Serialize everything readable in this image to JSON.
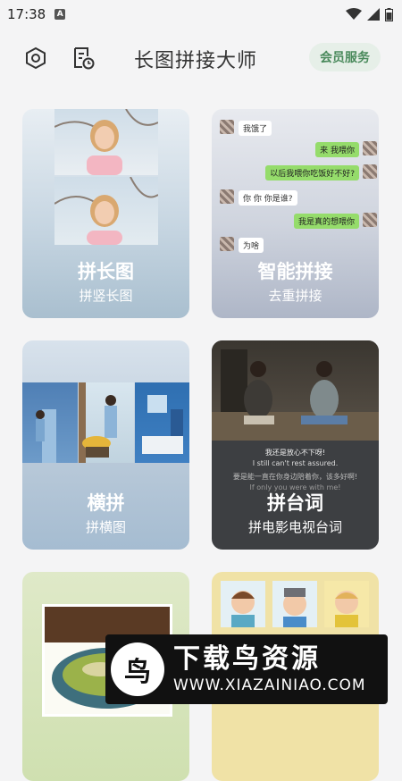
{
  "status": {
    "time": "17:38",
    "notif_badge": "A"
  },
  "header": {
    "title": "长图拼接大师",
    "vip_label": "会员服务",
    "icons": [
      "settings-hex-icon",
      "history-icon"
    ]
  },
  "cards": [
    {
      "title": "拼长图",
      "subtitle": "拼竖长图"
    },
    {
      "title": "智能拼接",
      "subtitle": "去重拼接",
      "chat": [
        "我饿了",
        "来 我喂你",
        "以后我喂你吃饭好不好?",
        "你 你 你是谁?",
        "我是真的想喂你",
        "为啥"
      ]
    },
    {
      "title": "横拼",
      "subtitle": "拼横图"
    },
    {
      "title": "拼台词",
      "subtitle": "拼电影电视台词",
      "subtitles": [
        "我还是放心不下呀!",
        "I still can't rest assured.",
        "要是能一直在你身边陪着你，该多好啊!",
        "If only you were with me!"
      ]
    },
    {
      "title": "",
      "subtitle": ""
    },
    {
      "title": "",
      "subtitle": ""
    }
  ],
  "watermark": {
    "brand": "下载鸟资源",
    "url": "WWW.XIAZAINIAO.COM",
    "logo_glyph": "鸟"
  },
  "colors": {
    "accent_green": "#4a8a5c",
    "vip_bg": "#e6efe8",
    "bubble_green": "#95dc6b"
  }
}
